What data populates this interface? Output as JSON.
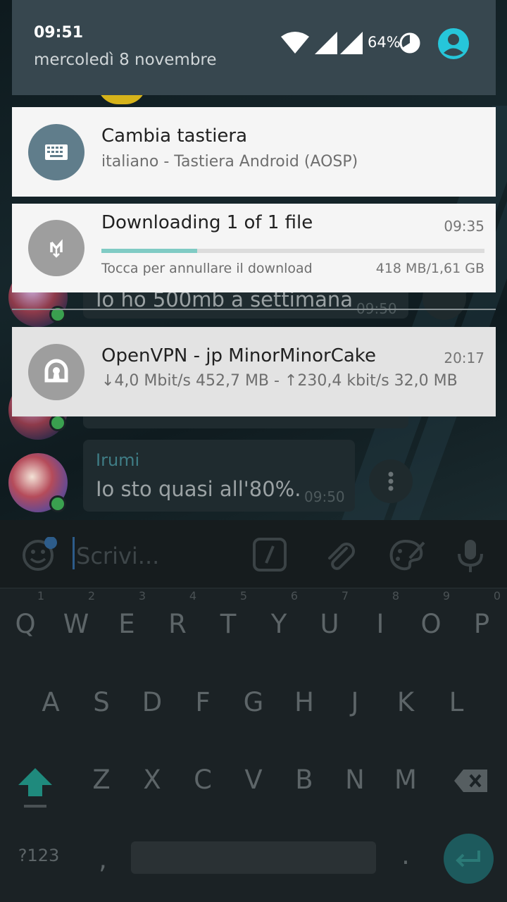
{
  "status_bar": {
    "time": "09:51",
    "date": "mercoledì 8 novembre",
    "battery_percent": "64%",
    "icons": [
      "wifi-icon",
      "signal-icon",
      "signal-icon",
      "battery-icon",
      "user-account-icon"
    ],
    "user_icon_color": "#26c6da"
  },
  "notifications": [
    {
      "icon": "keyboard-icon",
      "icon_bg": "#607d8b",
      "title": "Cambia tastiera",
      "subtitle": "italiano - Tastiera Android (AOSP)"
    },
    {
      "icon": "download-icon",
      "icon_bg": "#9e9e9e",
      "title": "Downloading 1 of 1 file",
      "time": "09:35",
      "progress": 0.25,
      "subtitle": "Tocca per annullare il download",
      "size": "418 MB/1,61 GB"
    },
    {
      "icon": "openvpn-icon",
      "icon_bg": "#9e9e9e",
      "title": "OpenVPN - jp MinorMinorCake",
      "time": "20:17",
      "subtitle": "↓4,0 Mbit/s 452,7 MB - ↑230,4 kbit/s 32,0 MB"
    }
  ],
  "chat": {
    "messages": [
      {
        "text": "Io ho 500mb a settimana",
        "time": "09:50"
      },
      {
        "sender": "Irumi",
        "text": "Io sto quasi all'80%.",
        "time": "09:50"
      }
    ],
    "input_placeholder": "Scrivi..."
  },
  "keyboard": {
    "row1": [
      "Q",
      "W",
      "E",
      "R",
      "T",
      "Y",
      "U",
      "I",
      "O",
      "P"
    ],
    "row1_hints": [
      "1",
      "2",
      "3",
      "4",
      "5",
      "6",
      "7",
      "8",
      "9",
      "0"
    ],
    "row2": [
      "A",
      "S",
      "D",
      "F",
      "G",
      "H",
      "J",
      "K",
      "L"
    ],
    "row3": [
      "Z",
      "X",
      "C",
      "V",
      "B",
      "N",
      "M"
    ],
    "symbols_key": "?123",
    "comma_key": ",",
    "period_key": "."
  }
}
